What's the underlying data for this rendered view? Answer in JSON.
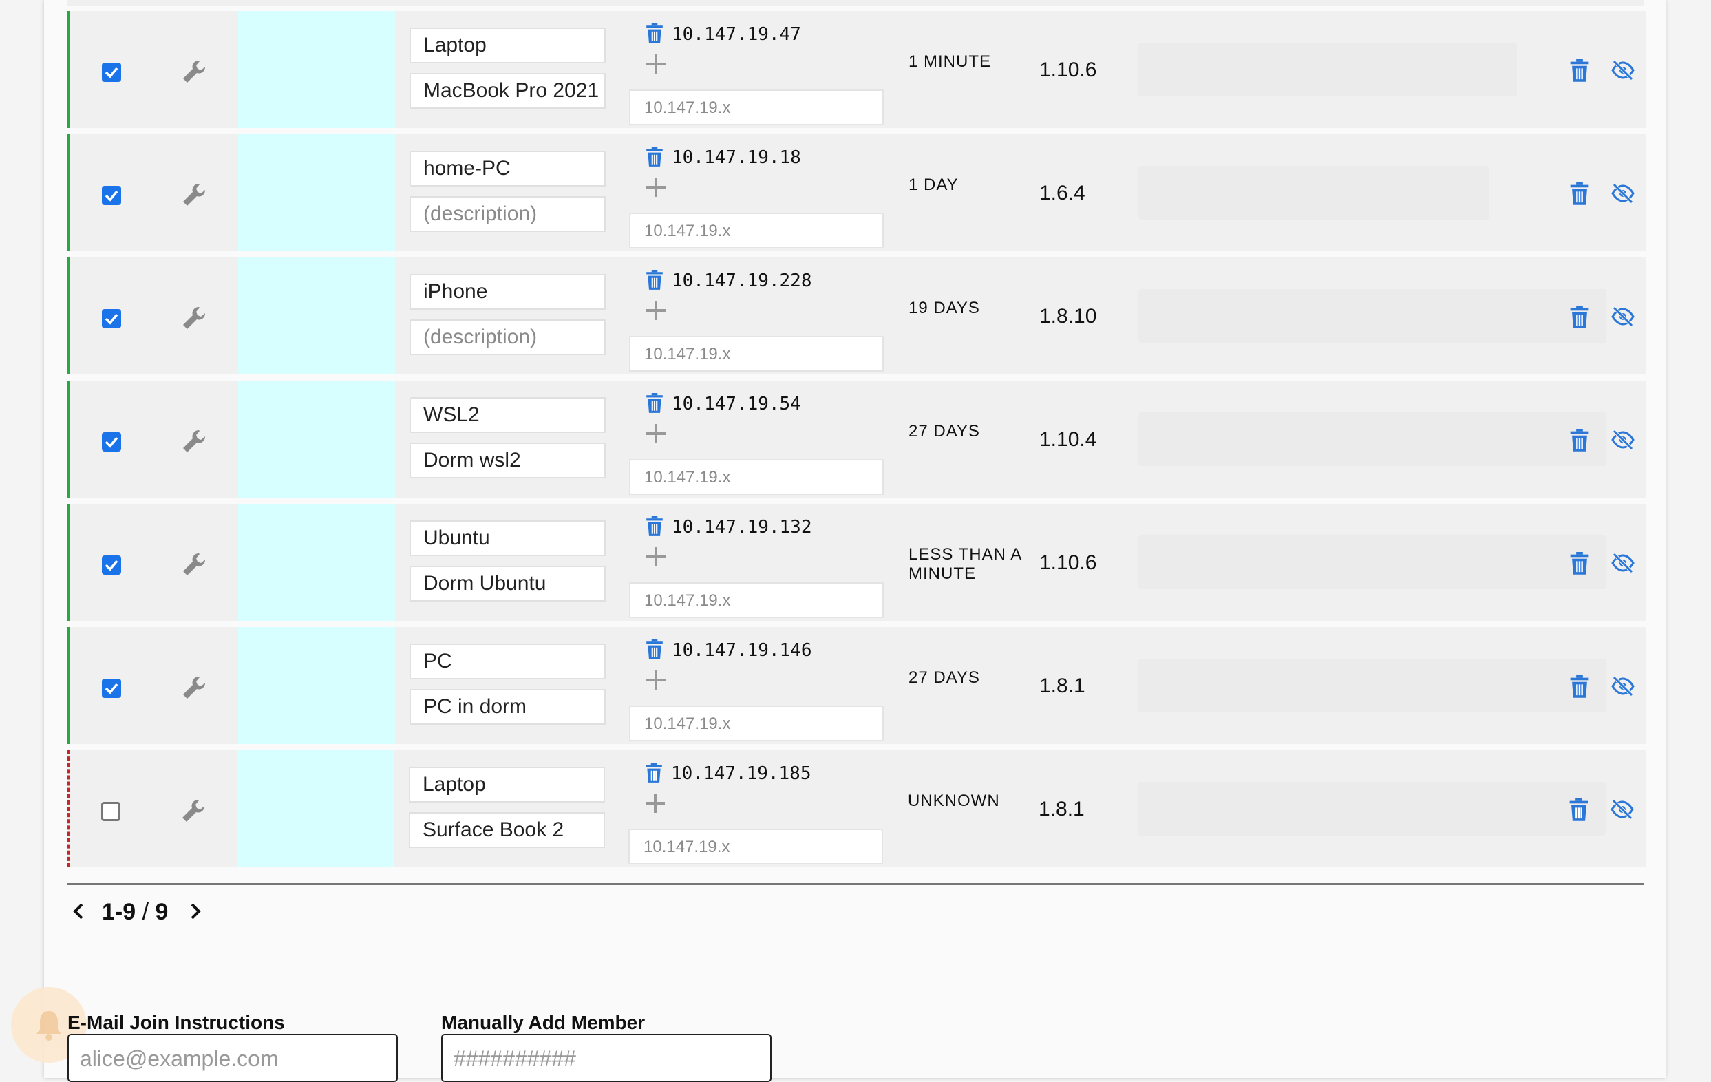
{
  "members": [
    {
      "authorized": true,
      "name": "Laptop",
      "description": "MacBook Pro 2021",
      "description_is_placeholder": false,
      "ip": "10.147.19.47",
      "ip_placeholder": "10.147.19.x",
      "last_seen": "1 MINUTE",
      "version": "1.10.6"
    },
    {
      "authorized": true,
      "name": "home-PC",
      "description": "(description)",
      "description_is_placeholder": true,
      "ip": "10.147.19.18",
      "ip_placeholder": "10.147.19.x",
      "last_seen": "1 DAY",
      "version": "1.6.4"
    },
    {
      "authorized": true,
      "name": "iPhone",
      "description": "(description)",
      "description_is_placeholder": true,
      "ip": "10.147.19.228",
      "ip_placeholder": "10.147.19.x",
      "last_seen": "19 DAYS",
      "version": "1.8.10"
    },
    {
      "authorized": true,
      "name": "WSL2",
      "description": "Dorm wsl2",
      "description_is_placeholder": false,
      "ip": "10.147.19.54",
      "ip_placeholder": "10.147.19.x",
      "last_seen": "27 DAYS",
      "version": "1.10.4"
    },
    {
      "authorized": true,
      "name": "Ubuntu",
      "description": "Dorm Ubuntu",
      "description_is_placeholder": false,
      "ip": "10.147.19.132",
      "ip_placeholder": "10.147.19.x",
      "last_seen": "LESS THAN A MINUTE",
      "version": "1.10.6"
    },
    {
      "authorized": true,
      "name": "PC",
      "description": "PC in dorm",
      "description_is_placeholder": false,
      "ip": "10.147.19.146",
      "ip_placeholder": "10.147.19.x",
      "last_seen": "27 DAYS",
      "version": "1.8.1"
    },
    {
      "authorized": false,
      "name": "Laptop",
      "description": "Surface Book 2",
      "description_is_placeholder": false,
      "ip": "10.147.19.185",
      "ip_placeholder": "10.147.19.x",
      "last_seen": "UNKNOWN",
      "version": "1.8.1"
    }
  ],
  "pagination": {
    "range": "1-9",
    "separator": " / ",
    "total": "9"
  },
  "email_join": {
    "label": "E-Mail Join Instructions",
    "placeholder": "alice@example.com"
  },
  "manual_add": {
    "label": "Manually Add Member",
    "placeholder": "##########"
  },
  "icons": {
    "row_settings": "wrench-icon",
    "ip_delete": "trash-icon",
    "ip_add": "plus-icon",
    "row_delete": "trash-icon",
    "row_hide": "eye-slash-icon",
    "prev_page": "chevron-left-icon",
    "next_page": "chevron-right-icon",
    "notifications": "bell-icon"
  },
  "colors": {
    "accent": "#1a73e8",
    "authorized": "#28a745",
    "unauthorized": "#c0282d",
    "row_highlight": "#d8ffff",
    "icon_blue": "#2b77d8"
  }
}
